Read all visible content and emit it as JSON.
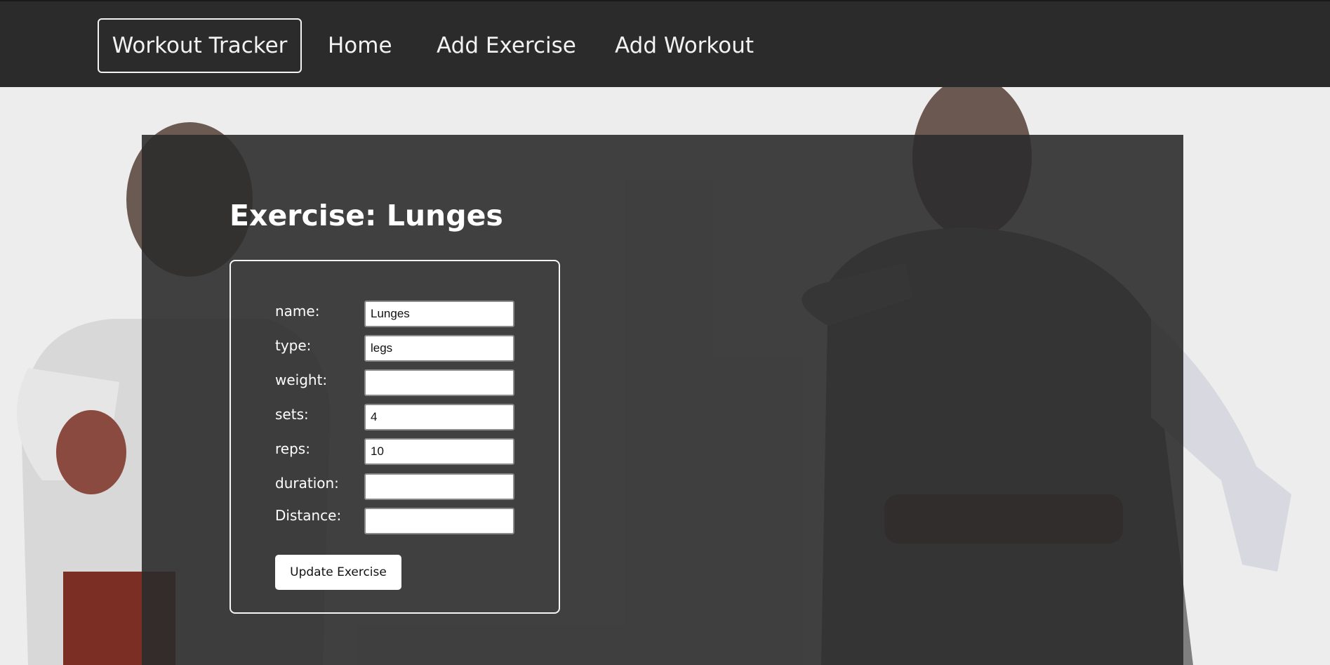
{
  "navbar": {
    "brand": "Workout Tracker",
    "links": [
      {
        "label": "Home"
      },
      {
        "label": "Add Exercise"
      },
      {
        "label": "Add Workout"
      }
    ]
  },
  "page": {
    "title": "Exercise: Lunges"
  },
  "form": {
    "fields": [
      {
        "label": "name:",
        "value": "Lunges"
      },
      {
        "label": "type:",
        "value": "legs"
      },
      {
        "label": "weight:",
        "value": ""
      },
      {
        "label": "sets:",
        "value": "4"
      },
      {
        "label": "reps:",
        "value": "10"
      },
      {
        "label": "duration:",
        "value": ""
      },
      {
        "label": "Distance:",
        "value": ""
      }
    ],
    "submit_label": "Update Exercise"
  },
  "colors": {
    "navbar": "#2b2b2b",
    "page_background": "#ededed",
    "card": "#2c2c2c",
    "text": "#ffffff"
  },
  "background_image": {
    "icon": "two-people-pointing-image"
  }
}
